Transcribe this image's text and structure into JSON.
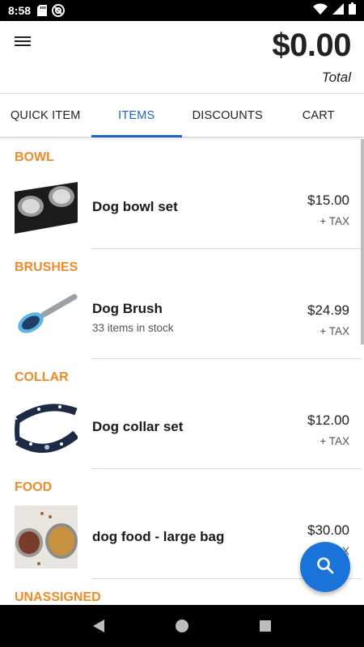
{
  "status_bar": {
    "time": "8:58",
    "icons_left": [
      "sd-card-icon",
      "at-sign-icon"
    ],
    "icons_right": [
      "wifi-icon",
      "signal-icon",
      "battery-icon"
    ]
  },
  "header": {
    "menu_icon": "hamburger-menu-icon",
    "total_amount": "$0.00",
    "total_label": "Total"
  },
  "tabs": [
    {
      "label": "QUICK ITEM",
      "active": false
    },
    {
      "label": "ITEMS",
      "active": true
    },
    {
      "label": "DISCOUNTS",
      "active": false
    },
    {
      "label": "CART",
      "active": false
    }
  ],
  "sections": [
    {
      "title": "BOWL",
      "items": [
        {
          "name": "Dog bowl set",
          "stock": "",
          "price": "$15.00",
          "tax": "+ TAX"
        }
      ]
    },
    {
      "title": "BRUSHES",
      "items": [
        {
          "name": "Dog Brush",
          "stock": "33 items in stock",
          "price": "$24.99",
          "tax": "+ TAX"
        }
      ]
    },
    {
      "title": "COLLAR",
      "items": [
        {
          "name": "Dog collar set",
          "stock": "",
          "price": "$12.00",
          "tax": "+ TAX"
        }
      ]
    },
    {
      "title": "FOOD",
      "items": [
        {
          "name": "dog food - large bag",
          "stock": "",
          "price": "$30.00",
          "tax": "+ TAX"
        }
      ]
    },
    {
      "title": "UNASSIGNED",
      "items": []
    }
  ],
  "fab": {
    "icon": "search-icon"
  },
  "colors": {
    "accent": "#1a63c6",
    "section_header": "#f08a24",
    "fab": "#1a73d9"
  },
  "nav_bar": {
    "buttons": [
      "back-icon",
      "home-icon",
      "recents-icon"
    ]
  }
}
